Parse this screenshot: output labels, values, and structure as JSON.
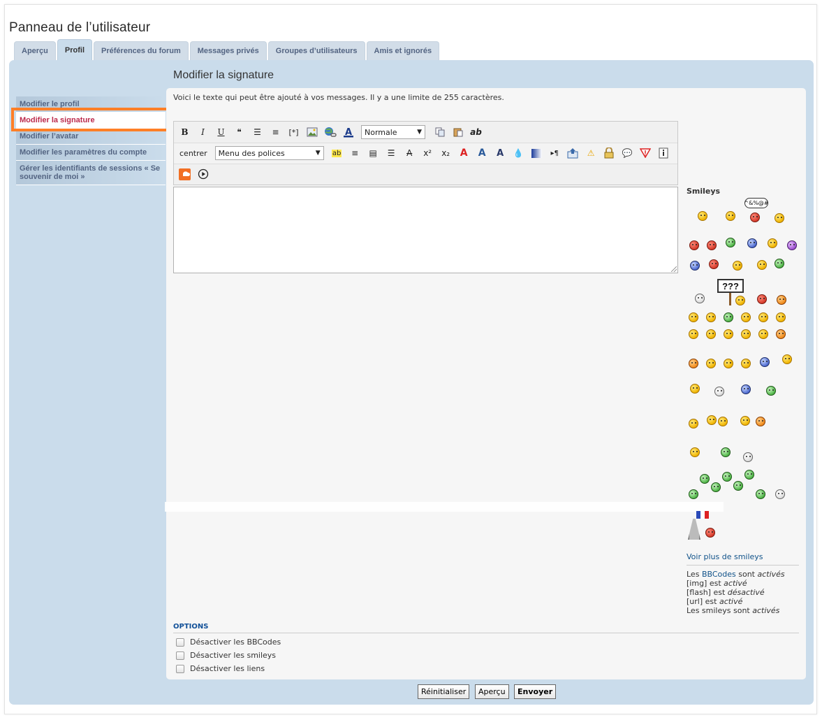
{
  "page": {
    "title": "Panneau de l’utilisateur"
  },
  "tabs": [
    {
      "label": "Aperçu"
    },
    {
      "label": "Profil"
    },
    {
      "label": "Préférences du forum"
    },
    {
      "label": "Messages privés"
    },
    {
      "label": "Groupes d’utilisateurs"
    },
    {
      "label": "Amis et ignorés"
    }
  ],
  "active_tab": "Profil",
  "sidebar": {
    "items": [
      {
        "label": "Modifier le profil"
      },
      {
        "label": "Modifier la signature"
      },
      {
        "label": "Modifier l’avatar"
      },
      {
        "label": "Modifier les paramètres du compte"
      },
      {
        "label": "Gérer les identifiants de sessions « Se souvenir de moi »"
      }
    ],
    "active": "Modifier la signature"
  },
  "main": {
    "title": "Modifier la signature",
    "intro": "Voici le texte qui peut être ajouté à vos messages. Il y a une limite de 255 caractères.",
    "signature_value": ""
  },
  "toolbar": {
    "bold": "B",
    "italic": "I",
    "underline": "U",
    "code": "[*]",
    "size_select": "Normale",
    "spell": "ab",
    "center": "centrer",
    "font_select": "Menu des polices"
  },
  "smileys": {
    "title": "Smileys",
    "bubble_text": "^&%@#",
    "sign_text": "???",
    "more_link": "Voir plus de smileys"
  },
  "bbcode_status": {
    "bbcodes_prefix": "Les ",
    "bbcodes_link": "BBCodes",
    "bbcodes_mid": " sont ",
    "bbcodes_state": "activés",
    "img_label": "[img] est ",
    "img_state": "activé",
    "flash_label": "[flash] est ",
    "flash_state": "désactivé",
    "url_label": "[url] est ",
    "url_state": "activé",
    "smileys_label": "Les smileys sont ",
    "smileys_state": "activés"
  },
  "options": {
    "title": "OPTIONS",
    "items": [
      {
        "label": "Désactiver les BBCodes",
        "checked": false
      },
      {
        "label": "Désactiver les smileys",
        "checked": false
      },
      {
        "label": "Désactiver les liens",
        "checked": false
      }
    ]
  },
  "buttons": {
    "reset": "Réinitialiser",
    "preview": "Aperçu",
    "submit": "Envoyer"
  },
  "colors": {
    "accent": "#BC2A4D",
    "panel": "#CADCEB",
    "link": "#105289",
    "highlight": "#FF7F27"
  }
}
